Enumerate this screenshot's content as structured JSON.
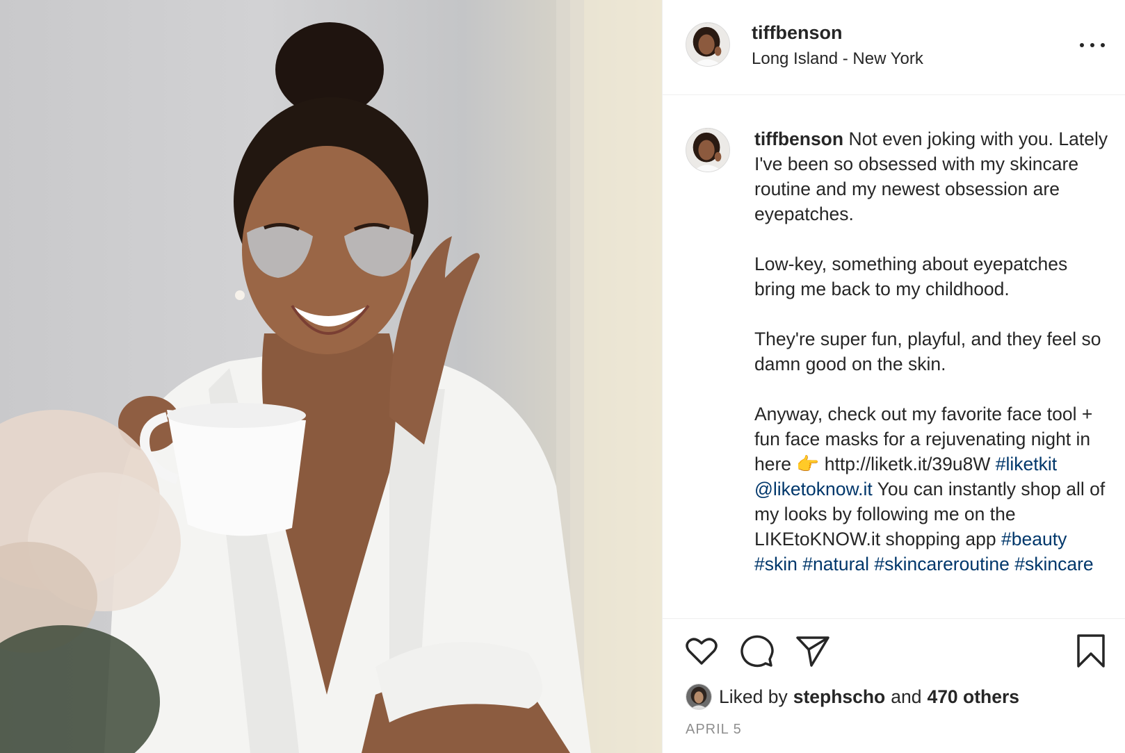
{
  "post": {
    "author": {
      "username": "tiffbenson",
      "location": "Long Island - New York"
    },
    "more_label": "More options",
    "caption": {
      "username": "tiffbenson",
      "paragraph1": "Not even joking with you. Lately I've been so obsessed with my skincare routine and my newest obsession are eyepatches.",
      "paragraph2": "Low-key, something about eyepatches bring me back to my childhood.",
      "paragraph3": "They're super fun, playful, and they feel so damn good on the skin.",
      "paragraph4_text": "Anyway, check out my favorite face tool + fun face masks for a rejuvenating night in here",
      "pointing_emoji": "👉",
      "link_url": "http://liketk.it/39u8W",
      "hashtag_liketkit": "#liketkit",
      "mention": "@liketoknow.it",
      "paragraph4_text2": "You can instantly shop all of my looks by following me on the LIKEtoKNOW.it shopping app",
      "hashtags": [
        "#beauty",
        "#skin",
        "#natural",
        "#skincareroutine",
        "#skincare"
      ]
    },
    "likes": {
      "prefix": "Liked by",
      "liker": "stephscho",
      "joiner": "and",
      "others": "470 others"
    },
    "date": "APRIL 5"
  },
  "icons": {
    "like": "heart-icon",
    "comment": "comment-icon",
    "share": "paper-plane-icon",
    "save": "bookmark-icon",
    "more": "ellipsis-icon"
  },
  "colors": {
    "text": "#262626",
    "link": "#00376b",
    "muted": "#8e8e8e",
    "border": "#efefef"
  }
}
